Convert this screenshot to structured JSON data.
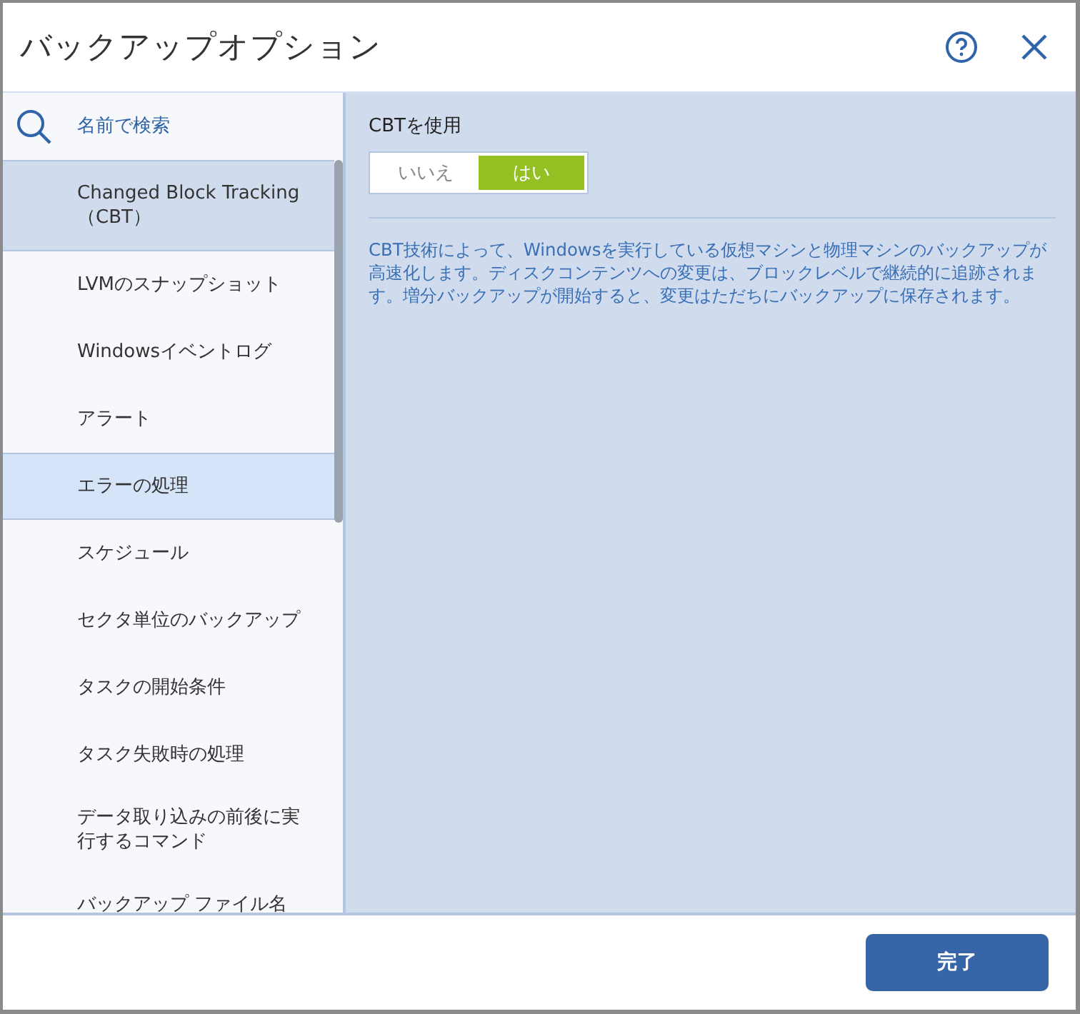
{
  "window": {
    "title": "バックアップオプション"
  },
  "search": {
    "placeholder": "名前で検索"
  },
  "sidebar": {
    "items": [
      {
        "label": "Changed Block Tracking（CBT）",
        "selected": true,
        "hovered": false
      },
      {
        "label": "LVMのスナップショット",
        "selected": false,
        "hovered": false
      },
      {
        "label": "Windowsイベントログ",
        "selected": false,
        "hovered": false
      },
      {
        "label": "アラート",
        "selected": false,
        "hovered": false
      },
      {
        "label": "エラーの処理",
        "selected": false,
        "hovered": true
      },
      {
        "label": "スケジュール",
        "selected": false,
        "hovered": false
      },
      {
        "label": "セクタ単位のバックアップ",
        "selected": false,
        "hovered": false
      },
      {
        "label": "タスクの開始条件",
        "selected": false,
        "hovered": false
      },
      {
        "label": "タスク失敗時の処理",
        "selected": false,
        "hovered": false
      },
      {
        "label": "データ取り込みの前後に実行するコマンド",
        "selected": false,
        "hovered": false
      },
      {
        "label": "バックアップ ファイル名",
        "selected": false,
        "hovered": false
      }
    ]
  },
  "setting": {
    "label": "CBTを使用",
    "options": [
      {
        "label": "いいえ",
        "selected": false
      },
      {
        "label": "はい",
        "selected": true
      }
    ],
    "description": "CBT技術によって、Windowsを実行している仮想マシンと物理マシンのバックアップが高速化します。ディスクコンテンツへの変更は、ブロックレベルで継続的に追跡されます。増分バックアップが開始すると、変更はただちにバックアップに保存されます。"
  },
  "buttons": [
    {
      "label": "完了"
    }
  ]
}
